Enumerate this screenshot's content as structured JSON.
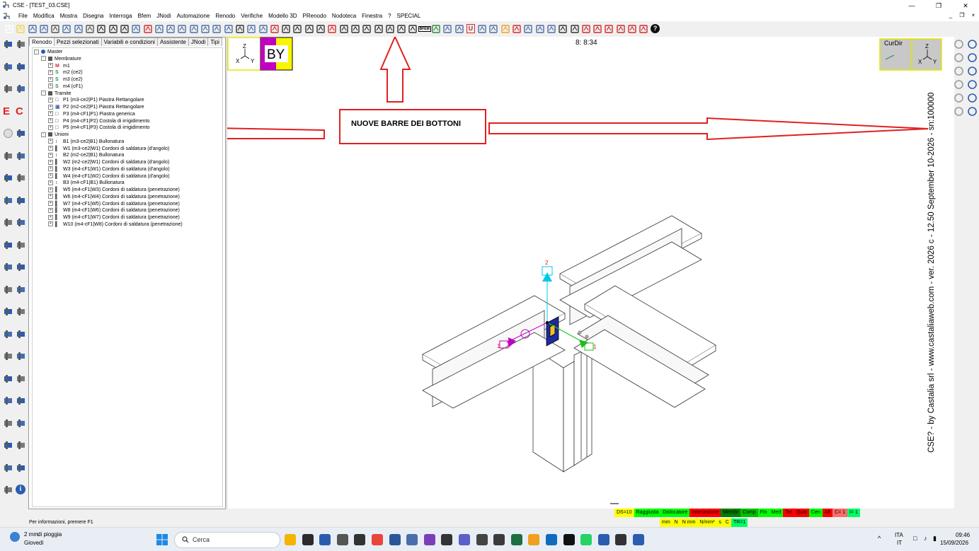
{
  "window": {
    "title": "CSE - [TEST_03.CSE]",
    "controls": [
      "—",
      "❐",
      "✕"
    ]
  },
  "menu": {
    "items": [
      "File",
      "Modifica",
      "Mostra",
      "Disegna",
      "Interroga",
      "Bfem",
      "JNodi",
      "Automazione",
      "Renodo",
      "Verifiche",
      "Modello 3D",
      "PRenodo",
      "Nodoteca",
      "Finestra",
      "?",
      "SPECIAL"
    ],
    "right": [
      "_",
      "❐",
      "×"
    ]
  },
  "toolbar": {
    "buttons": [
      {
        "icon": "new-icon",
        "color": "#ffffff"
      },
      {
        "icon": "open-icon",
        "color": "#f4d44a"
      },
      {
        "icon": "save-icon",
        "color": "#4a6ea9"
      },
      {
        "icon": "save-as-icon",
        "color": "#4a6ea9"
      },
      {
        "icon": "camera-icon",
        "color": "#555555"
      },
      {
        "icon": "copy-icon",
        "color": "#4a6ea9"
      },
      {
        "icon": "paste-icon",
        "color": "#4a6ea9"
      },
      {
        "icon": "print-icon",
        "color": "#555555"
      },
      {
        "icon": "undo-icon",
        "color": "#333333"
      },
      {
        "icon": "redo-icon",
        "color": "#333333"
      },
      {
        "icon": "select-arrow-icon",
        "color": "#333333"
      },
      {
        "icon": "window-select-icon",
        "color": "#4a6ea9"
      },
      {
        "icon": "dimension-icon",
        "color": "#d22b2b"
      },
      {
        "icon": "move-icon",
        "color": "#4a6ea9"
      },
      {
        "icon": "rotate-icon",
        "color": "#4a6ea9"
      },
      {
        "icon": "axis-icon",
        "color": "#4a6ea9"
      },
      {
        "icon": "axis-up-icon",
        "color": "#4a6ea9"
      },
      {
        "icon": "axis-down-icon",
        "color": "#4a6ea9"
      },
      {
        "icon": "axis-left-icon",
        "color": "#4a6ea9"
      },
      {
        "icon": "axis-right-icon",
        "color": "#4a6ea9"
      },
      {
        "icon": "frame-icon",
        "color": "#333333"
      },
      {
        "icon": "cube-icon",
        "color": "#4a6ea9"
      },
      {
        "icon": "render-icon",
        "color": "#4a6ea9"
      },
      {
        "icon": "section-icon",
        "color": "#d22b2b"
      },
      {
        "icon": "zoom-icon",
        "color": "#333333"
      },
      {
        "icon": "zoom-in-icon",
        "color": "#333333"
      },
      {
        "icon": "zoom-out-icon",
        "color": "#333333"
      },
      {
        "icon": "zoom-window-icon",
        "color": "#333333"
      },
      {
        "icon": "zoom-extents-icon",
        "color": "#d22b2b"
      },
      {
        "icon": "pan-icon",
        "color": "#333333"
      },
      {
        "icon": "orbit-icon",
        "color": "#333333"
      },
      {
        "icon": "eye-icon",
        "color": "#333333"
      },
      {
        "icon": "eye2-icon",
        "color": "#333333"
      },
      {
        "icon": "eye3-icon",
        "color": "#333333"
      },
      {
        "icon": "eye4-icon",
        "color": "#333333"
      },
      {
        "icon": "eye5-icon",
        "color": "#333333"
      },
      {
        "icon": "bfem-icon",
        "color": "#222222"
      },
      {
        "icon": "jnodi-icon",
        "color": "#2b8a3e"
      },
      {
        "icon": "node-icon",
        "color": "#4a6ea9"
      },
      {
        "icon": "wrench-icon",
        "color": "#4a6ea9"
      },
      {
        "icon": "u-icon",
        "color": "#d22b2b"
      },
      {
        "icon": "plus-icon",
        "color": "#4a6ea9"
      },
      {
        "icon": "minus-icon",
        "color": "#4a6ea9"
      },
      {
        "icon": "spark-icon",
        "color": "#f0a020"
      },
      {
        "icon": "delete-icon",
        "color": "#d22b2b"
      },
      {
        "icon": "star-icon",
        "color": "#4a6ea9"
      },
      {
        "icon": "plate-icon",
        "color": "#4a6ea9"
      },
      {
        "icon": "plate2-icon",
        "color": "#4a6ea9"
      },
      {
        "icon": "cut-icon",
        "color": "#333333"
      },
      {
        "icon": "beam-icon",
        "color": "#333333"
      },
      {
        "icon": "bracket-icon",
        "color": "#d22b2b"
      },
      {
        "icon": "bracket2-icon",
        "color": "#d22b2b"
      },
      {
        "icon": "bracket-q-icon",
        "color": "#d22b2b"
      },
      {
        "icon": "bracket3-icon",
        "color": "#d22b2b"
      },
      {
        "icon": "bracket4-icon",
        "color": "#d22b2b"
      },
      {
        "icon": "bracket-l-icon",
        "color": "#d22b2b"
      },
      {
        "icon": "help-icon",
        "color": "#111111"
      }
    ],
    "bfem_label": "BFEM",
    "u_label": "U",
    "help_label": "?"
  },
  "leftbar": {
    "icons": [
      "tool-icon",
      "tool-icon",
      "tool-icon",
      "tool-icon",
      "tool-icon",
      "tool-icon",
      "e-icon",
      "c-icon",
      "question-icon",
      "tool-icon",
      "tool-icon",
      "tool-icon",
      "tool-icon",
      "tool-icon",
      "tool-icon",
      "tool-icon",
      "tool-icon",
      "tool-icon",
      "tool-icon",
      "tool-icon",
      "tool-icon",
      "tool-icon",
      "tool-icon",
      "tool-icon",
      "tool-icon",
      "tool-icon",
      "tool-icon",
      "tool-icon",
      "tool-icon",
      "tool-icon",
      "tool-icon",
      "tool-icon",
      "tool-icon",
      "tool-icon",
      "tool-icon",
      "tool-icon",
      "tool-icon",
      "tool-icon",
      "tool-icon",
      "tool-icon",
      "tool-icon",
      "info-icon"
    ],
    "e_label": "E",
    "c_label": "C",
    "info_label": "i"
  },
  "panel": {
    "tabs": [
      "Renodo",
      "Pezzi selezionati",
      "Variabili e condizioni",
      "Assistente",
      "JNodi",
      "Tipi"
    ],
    "tree": [
      {
        "label": "Master",
        "level": 0,
        "icon": "master-icon"
      },
      {
        "label": "Membrature",
        "level": 1,
        "icon": "beam-icon"
      },
      {
        "label": "m1",
        "level": 2,
        "icon": "M",
        "iconColor": "#d22b2b"
      },
      {
        "label": "m2 (ce2)",
        "level": 2,
        "icon": "S",
        "iconColor": "#2b8a3e"
      },
      {
        "label": "m3 (ce2)",
        "level": 2,
        "icon": "S",
        "iconColor": "#2b8a3e"
      },
      {
        "label": "m4 (cF1)",
        "level": 2,
        "icon": "S",
        "iconColor": "#2b8a3e"
      },
      {
        "label": "Tramite",
        "level": 1,
        "icon": "tramite-icon"
      },
      {
        "label": "P1 (m3-ce2|P1)  Piastra Rettangolare",
        "level": 2,
        "icon": "□",
        "iconColor": "#333333"
      },
      {
        "label": "P2 (m2-ce2|P1)  Piastra Rettangolare",
        "level": 2,
        "icon": "▣",
        "iconColor": "#4a6ea9"
      },
      {
        "label": "P3 (m4-cF1|P1)  Piastra generica",
        "level": 2,
        "icon": "□",
        "iconColor": "#333333"
      },
      {
        "label": "P4 (m4-cF1|P2)  Costola di irrigidimento",
        "level": 2,
        "icon": "□",
        "iconColor": "#333333"
      },
      {
        "label": "P5 (m4-cF1|P3)  Costola di irrigidimento",
        "level": 2,
        "icon": "□",
        "iconColor": "#333333"
      },
      {
        "label": "Unioni",
        "level": 1,
        "icon": "unioni-icon"
      },
      {
        "label": "B1 (m3-ce2|B1)  Bullonatura",
        "level": 2,
        "icon": "↕",
        "iconColor": "#333333"
      },
      {
        "label": "W1 (m3-ce2|W1)  Cordoni di saldatura (d'angolo)",
        "level": 2,
        "icon": "▌",
        "iconColor": "#555555"
      },
      {
        "label": "B2 (m2-ce2|B1)  Bullonatura",
        "level": 2,
        "icon": "↕",
        "iconColor": "#333333"
      },
      {
        "label": "W2 (m2-ce2|W1)  Cordoni di saldatura (d'angolo)",
        "level": 2,
        "icon": "▌",
        "iconColor": "#555555"
      },
      {
        "label": "W3 (m4-cF1|W1)  Cordoni di saldatura (d'angolo)",
        "level": 2,
        "icon": "▌",
        "iconColor": "#555555"
      },
      {
        "label": "W4 (m4-cF1|W2)  Cordoni di saldatura (d'angolo)",
        "level": 2,
        "icon": "▌",
        "iconColor": "#555555"
      },
      {
        "label": "B3 (m4-cF1|B1)  Bullonatura",
        "level": 2,
        "icon": "↕",
        "iconColor": "#333333"
      },
      {
        "label": "W5 (m4-cF1|W3)  Cordoni di saldatura (penetrazione)",
        "level": 2,
        "icon": "▌",
        "iconColor": "#555555"
      },
      {
        "label": "W6 (m4-cF1|W4)  Cordoni di saldatura (penetrazione)",
        "level": 2,
        "icon": "▌",
        "iconColor": "#555555"
      },
      {
        "label": "W7 (m4-cF1|W5)  Cordoni di saldatura (penetrazione)",
        "level": 2,
        "icon": "▌",
        "iconColor": "#555555"
      },
      {
        "label": "W8 (m4-cF1|W6)  Cordoni di saldatura (penetrazione)",
        "level": 2,
        "icon": "▌",
        "iconColor": "#555555"
      },
      {
        "label": "W9 (m4-cF1|W7)  Cordoni di saldatura (penetrazione)",
        "level": 2,
        "icon": "▌",
        "iconColor": "#555555"
      },
      {
        "label": "W10 (m4-cF1|W8)  Cordoni di saldatura (penetrazione)",
        "level": 2,
        "icon": "▌",
        "iconColor": "#555555"
      }
    ]
  },
  "canvas": {
    "counter": "8: 8:34",
    "view_label": "BY",
    "axes": {
      "z": "Z",
      "x": "X",
      "y": "Y"
    },
    "curdir_label": "CurDir",
    "annotation": "NUOVE BARRE DEI BOTTONI",
    "vertical_text": "CSE? - by Castalia srl - www.castaliaweb.com - ver. 2026 c - 12.50 September 10-2026 - sn:100000",
    "node_labels": {
      "n1": "1",
      "n2": "2",
      "n3": "1"
    },
    "colors": {
      "annotation": "#e02020",
      "magenta": "#c000c0",
      "yellow": "#f6f600",
      "cyan": "#00c8e8",
      "green": "#18c018"
    }
  },
  "rightbar": {
    "icons": [
      "tool-icon",
      "tool-icon",
      "tool-icon",
      "tool-icon",
      "tool-icon",
      "tool-icon",
      "tool-icon",
      "tool-icon",
      "tool-icon",
      "tool-icon",
      "tool-icon",
      "tool-icon"
    ]
  },
  "status": {
    "row1": [
      {
        "text": "DS=10",
        "bg": "#ffff00"
      },
      {
        "text": "Raggiusta",
        "bg": "#00ff00"
      },
      {
        "text": "Dislocatore",
        "bg": "#00ff00"
      },
      {
        "text": "Intersezione",
        "bg": "#ff0000"
      },
      {
        "text": "Membr",
        "bg": "#008000"
      },
      {
        "text": "Comp",
        "bg": "#00c000"
      },
      {
        "text": "Fin",
        "bg": "#00ff00"
      },
      {
        "text": "Med",
        "bg": "#00ff00"
      },
      {
        "text": "Ter",
        "bg": "#ff0000"
      },
      {
        "text": "Quat",
        "bg": "#ff0000"
      },
      {
        "text": "Cen",
        "bg": "#00ff00"
      },
      {
        "text": "Alt",
        "bg": "#ff0000"
      },
      {
        "text": "C=  1",
        "bg": "#ff6a6a"
      },
      {
        "text": "I=  1",
        "bg": "#00ff66"
      }
    ],
    "row2": [
      {
        "text": "mm",
        "bg": "#ffff00"
      },
      {
        "text": "N",
        "bg": "#ffff00"
      },
      {
        "text": "N mm",
        "bg": "#ffff00"
      },
      {
        "text": "N/mm²",
        "bg": "#ffff00"
      },
      {
        "text": "s",
        "bg": "#ffff00"
      },
      {
        "text": "C",
        "bg": "#ffff00"
      },
      {
        "text": "TR=1",
        "bg": "#00ff66"
      }
    ],
    "info": "Per informazioni, premere F1"
  },
  "taskbar": {
    "weather_temp": "2 mm",
    "weather_text": "di pioggia",
    "weather_day": "Giovedì",
    "search_placeholder": "Cerca",
    "lang1": "ITA",
    "lang2": "IT",
    "time": "09:46",
    "date": "15/09/2026",
    "apps": [
      "file-explorer-icon",
      "app-icon",
      "app-icon",
      "app-icon",
      "app-icon",
      "chrome-icon",
      "word-icon",
      "app-icon",
      "app-icon",
      "app-icon",
      "app-icon",
      "app-icon",
      "app-icon",
      "excel-icon",
      "app-icon",
      "outlook-icon",
      "app-icon",
      "whatsapp-icon",
      "cse-icon",
      "app-icon",
      "cse-active-icon"
    ]
  }
}
